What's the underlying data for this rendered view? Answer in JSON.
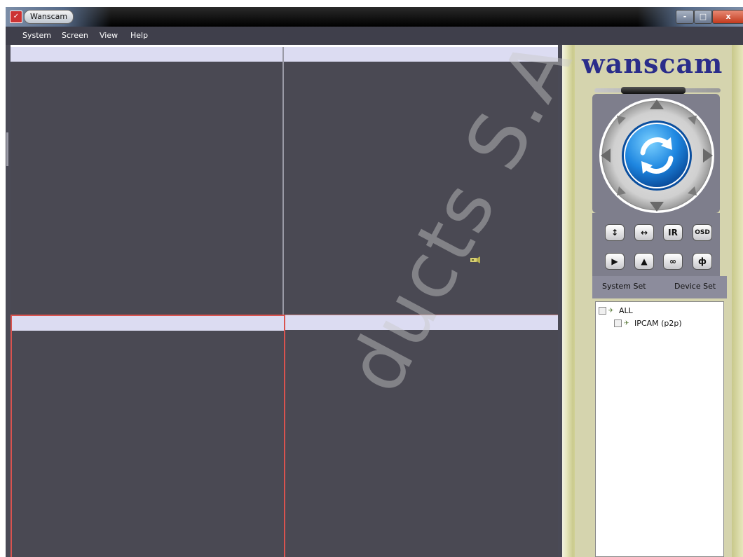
{
  "window": {
    "title": "Wanscam",
    "controls": {
      "minimize": "-",
      "maximize": "□",
      "close": "x"
    }
  },
  "menu": [
    "System",
    "Screen",
    "View",
    "Help"
  ],
  "sidebar": {
    "logo": "wanscam",
    "buttons_row1": [
      "↕",
      "↔",
      "IR",
      "OSD"
    ],
    "buttons_row2": [
      "▶",
      "▲",
      "∞",
      "ф"
    ],
    "system_set_label": "System Set",
    "device_set_label": "Device Set",
    "tree": {
      "root": "ALL",
      "children": [
        "IPCAM (p2p)"
      ]
    }
  },
  "icons": {
    "app": "camera-app-icon",
    "ptz_center": "refresh-icon",
    "pane_camera": "camera-icon"
  },
  "watermark": "ducts S.A",
  "colors": {
    "menubar": "#3f3f4b",
    "pane": "#4a4953",
    "pane_header": "#dcdcf2",
    "selected_border": "#d9534f",
    "logo": "#2a2d8a",
    "ptz_button": "#2a8fe0"
  }
}
